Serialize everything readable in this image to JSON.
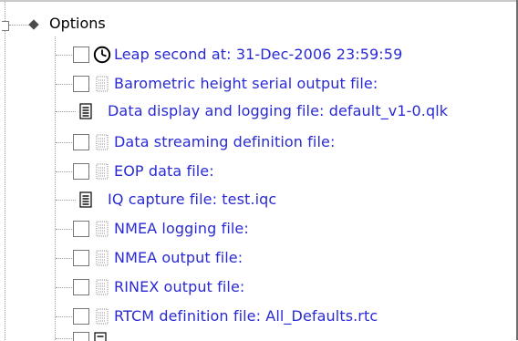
{
  "tree": {
    "root": {
      "label": "Options",
      "expander_icon": "tree-expander-icon",
      "node_icon": "diamond-node-icon"
    },
    "items": [
      {
        "label": "Leap second at: 31-Dec-2006 23:59:59",
        "checkbox": true,
        "checked": false,
        "icon": "clock-icon",
        "color": "#2a2ad4"
      },
      {
        "label": "Barometric height serial output file:",
        "checkbox": true,
        "checked": false,
        "icon": "file-dimmed-icon",
        "color": "#2a2ad4"
      },
      {
        "label": "Data display and logging file: default_v1-0.qlk",
        "checkbox": false,
        "icon": "document-icon",
        "color": "#2a2ad4"
      },
      {
        "label": "Data streaming definition file:",
        "checkbox": true,
        "checked": false,
        "icon": "file-dimmed-icon",
        "color": "#2a2ad4"
      },
      {
        "label": "EOP data file:",
        "checkbox": true,
        "checked": false,
        "icon": "file-dimmed-icon",
        "color": "#2a2ad4"
      },
      {
        "label": "IQ capture file: test.iqc",
        "checkbox": false,
        "icon": "document-icon",
        "color": "#2a2ad4"
      },
      {
        "label": "NMEA logging file:",
        "checkbox": true,
        "checked": false,
        "icon": "file-dimmed-icon",
        "color": "#2a2ad4"
      },
      {
        "label": "NMEA output file:",
        "checkbox": true,
        "checked": false,
        "icon": "file-dimmed-icon",
        "color": "#2a2ad4"
      },
      {
        "label": "RINEX output file:",
        "checkbox": true,
        "checked": false,
        "icon": "file-dimmed-icon",
        "color": "#2a2ad4"
      },
      {
        "label": "RTCM definition file: All_Defaults.rtc",
        "checkbox": true,
        "checked": false,
        "icon": "file-dimmed-icon",
        "color": "#2a2ad4"
      }
    ]
  }
}
